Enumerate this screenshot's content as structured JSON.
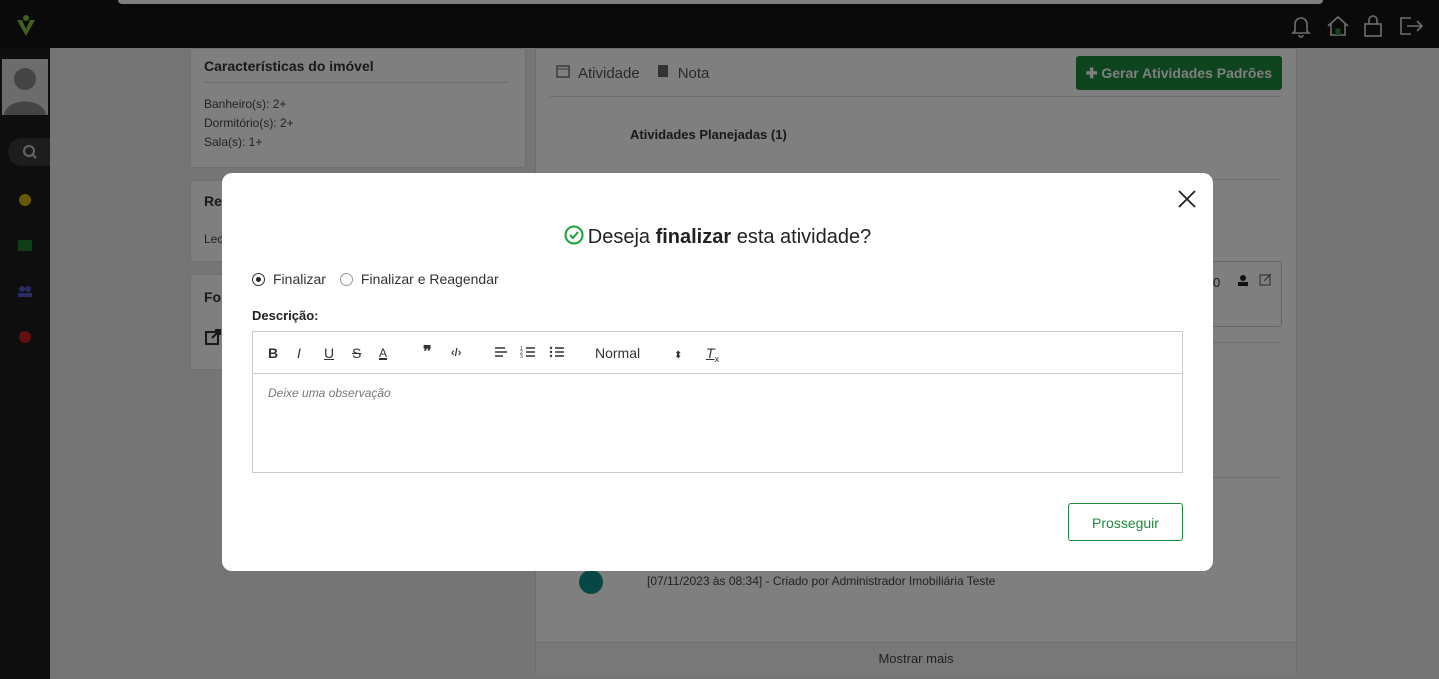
{
  "header": {
    "logo": "v-logo",
    "icons": [
      "bell-icon",
      "home-icon",
      "lock-icon",
      "logout-icon"
    ]
  },
  "sidebar": {
    "icons": [
      "search-icon",
      "dashboard-icon",
      "calendar-icon",
      "people-icon",
      "settings-icon"
    ]
  },
  "property": {
    "title": "Características do imóvel",
    "lines": [
      "Banheiro(s): 2+",
      "Dormitório(s): 2+",
      "Sala(s): 1+"
    ],
    "card2_title": "Re",
    "card2_text": "Lec",
    "card3_title": "Fo"
  },
  "activity": {
    "tab1": "Atividade",
    "tab2": "Nota",
    "generate_button": "Gerar Atividades Padrões",
    "planned_heading": "Atividades Planejadas (1)",
    "row_fragment": "0",
    "log_text": "[07/11/2023 às 08:34] - Criado por Administrador Imobiliária Teste",
    "show_more": "Mostrar mais"
  },
  "modal": {
    "title_prefix": "Deseja ",
    "title_bold": "finalizar",
    "title_suffix": " esta atividade?",
    "option1": "Finalizar",
    "option2": "Finalizar e Reagendar",
    "description_label": "Descrição:",
    "format_select": "Normal",
    "placeholder": "Deixe uma observação",
    "proceed_button": "Prosseguir"
  },
  "colors": {
    "accent": "#1e8a3c",
    "topbar": "#141414",
    "check": "#18a339"
  }
}
